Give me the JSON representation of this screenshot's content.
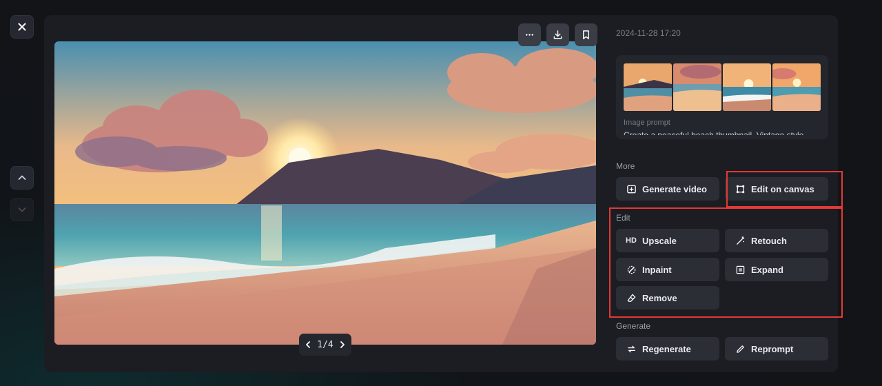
{
  "nav": {
    "close_icon": "close-icon",
    "prev_icon": "chevron-up-icon",
    "next_icon": "chevron-down-icon"
  },
  "toolbar": {
    "more_icon": "more-horizontal-icon",
    "download_icon": "download-icon",
    "bookmark_icon": "bookmark-icon"
  },
  "pager": {
    "label": "1/4"
  },
  "panel": {
    "timestamp": "2024-11-28 17:20",
    "prompt_label": "Image prompt",
    "prompt_text": "Create a peaceful beach thumbnail. Vintage style"
  },
  "more": {
    "label": "More",
    "generate_video": "Generate video",
    "edit_on_canvas": "Edit on canvas"
  },
  "edit": {
    "label": "Edit",
    "upscale_badge": "HD",
    "upscale": "Upscale",
    "retouch": "Retouch",
    "inpaint": "Inpaint",
    "expand": "Expand",
    "remove": "Remove"
  },
  "generate": {
    "label": "Generate",
    "regenerate": "Regenerate",
    "reprompt": "Reprompt"
  },
  "colors": {
    "highlight": "#e53935",
    "button_bg": "#2b2e35",
    "panel_bg": "#1b1d22"
  }
}
